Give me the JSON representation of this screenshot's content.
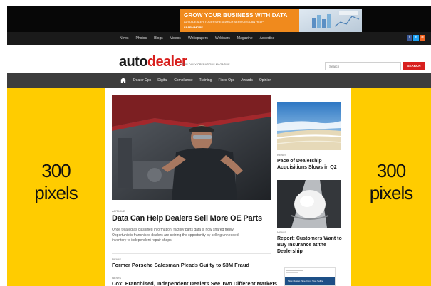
{
  "ad": {
    "title": "GROW YOUR BUSINESS WITH DATA",
    "subtitle": "AUTO DEALER TODAY'S RESEARCH SERVICES CAN HELP",
    "cta": "LEARN MORE"
  },
  "utility_nav": [
    "News",
    "Photos",
    "Blogs",
    "Videos",
    "Whitepapers",
    "Webinars",
    "Magazine",
    "Advertise"
  ],
  "social_icons": [
    "facebook-icon",
    "twitter-icon",
    "rss-icon"
  ],
  "colors": {
    "brand_red": "#d8201e",
    "side_slot_yellow": "#ffcc00",
    "nav_dark": "#3d3d3d",
    "ad_orange": "#f08a1d",
    "facebook_blue": "#3b5998",
    "twitter_blue": "#1da1f2",
    "rss_orange": "#f26522"
  },
  "logo": {
    "auto": "auto",
    "dealer": "dealer",
    "tagline": "YOUR DAILY OPERATIONS MAGAZINE"
  },
  "search": {
    "placeholder": "Search",
    "button": "SEARCH"
  },
  "main_nav": [
    "Dealer Ops",
    "Digital",
    "Compliance",
    "Training",
    "Fixed Ops",
    "Awards",
    "Opinion"
  ],
  "side_slots": {
    "left": [
      "300",
      "pixels"
    ],
    "right": [
      "300",
      "pixels"
    ]
  },
  "feature": {
    "kicker": "ARTICLE",
    "title": "Data Can Help Dealers Sell More OE Parts",
    "excerpt": [
      "Once treated as classified information, factory parts data is now shared freely.",
      "Opportunistic franchised dealers are seizing the opportunity by selling unneeded",
      "inventory to independent repair shops."
    ]
  },
  "list_items": [
    {
      "kicker": "NEWS",
      "title": "Former Porsche Salesman Pleads Guilty to $3M Fraud"
    },
    {
      "kicker": "NEWS",
      "title": "Cox: Franchised, Independent Dealers See Two Different Markets"
    }
  ],
  "side_articles": [
    {
      "kicker": "NEWS",
      "title_lines": [
        "Pace of Dealership",
        "Acquisitions Slows in Q2"
      ]
    },
    {
      "kicker": "NEWS",
      "title_lines": [
        "Report: Customers Want to",
        "Buy Insurance at the",
        "Dealership"
      ]
    }
  ],
  "promo": {
    "text": "Slow Closing Time, Don't Stop Selling"
  }
}
